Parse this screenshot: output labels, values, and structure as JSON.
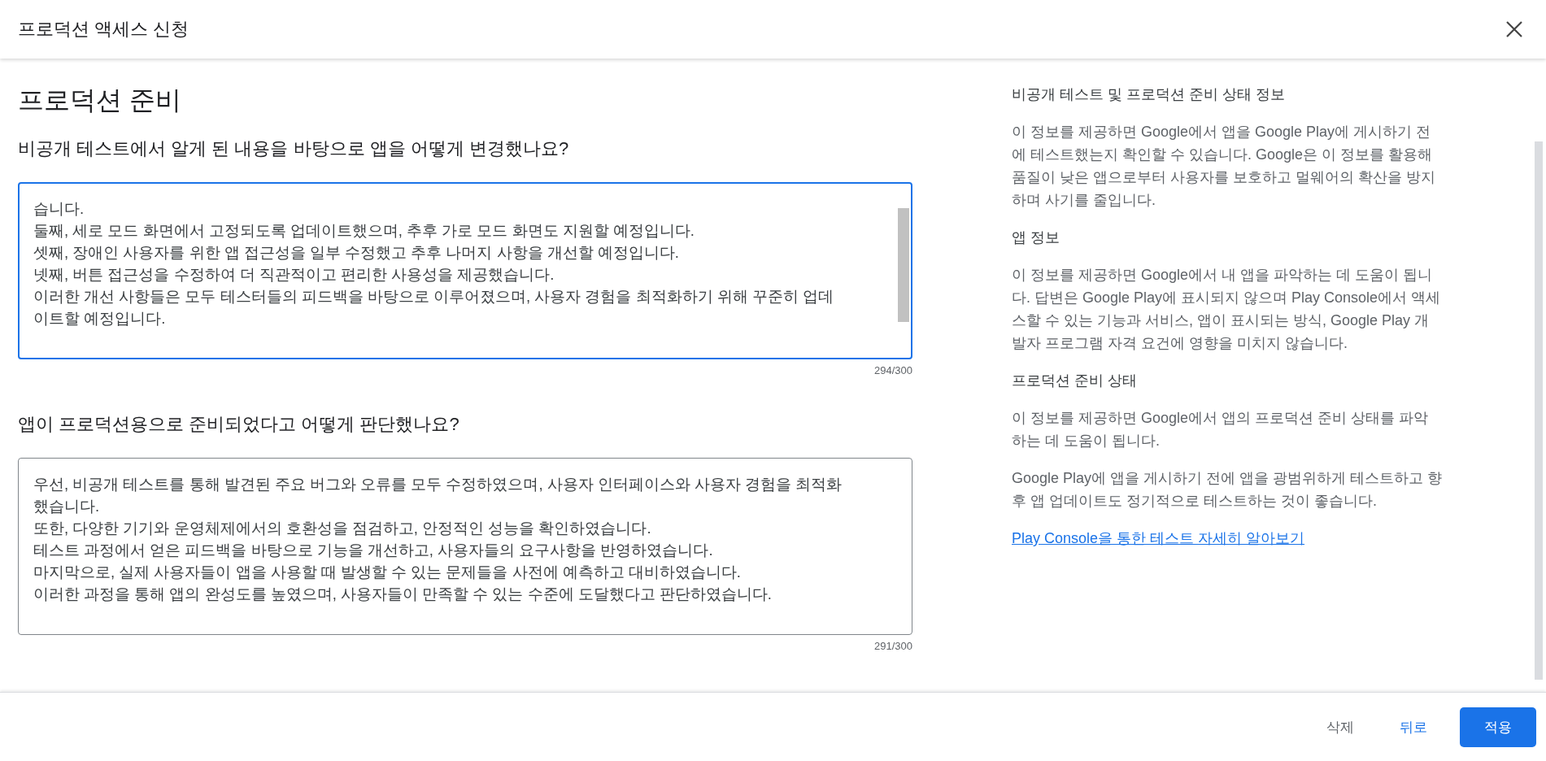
{
  "dialog": {
    "title": "프로덕션 액세스 신청"
  },
  "section_title": "프로덕션 준비",
  "questions": [
    {
      "label": "비공개 테스트에서 알게 된 내용을 바탕으로 앱을 어떻게 변경했나요?",
      "answer": "습니다.\n둘째, 세로 모드 화면에서 고정되도록 업데이트했으며, 추후 가로 모드 화면도 지원할 예정입니다.\n셋째, 장애인 사용자를 위한 앱 접근성을 일부 수정했고 추후 나머지 사항을 개선할 예정입니다.\n넷째, 버튼 접근성을 수정하여 더 직관적이고 편리한 사용성을 제공했습니다.\n이러한 개선 사항들은 모두 테스터들의 피드백을 바탕으로 이루어졌으며, 사용자 경험을 최적화하기 위해 꾸준히 업데\n이트할 예정입니다.",
      "counter": "294/300",
      "focused": true,
      "scrollable": true
    },
    {
      "label": "앱이 프로덕션용으로 준비되었다고 어떻게 판단했나요?",
      "answer": "우선, 비공개 테스트를 통해 발견된 주요 버그와 오류를 모두 수정하였으며, 사용자 인터페이스와 사용자 경험을 최적화\n했습니다.\n또한, 다양한 기기와 운영체제에서의 호환성을 점검하고, 안정적인 성능을 확인하였습니다.\n테스트 과정에서 얻은 피드백을 바탕으로 기능을 개선하고, 사용자들의 요구사항을 반영하였습니다.\n마지막으로, 실제 사용자들이 앱을 사용할 때 발생할 수 있는 문제들을 사전에 예측하고 대비하였습니다.\n이러한 과정을 통해 앱의 완성도를 높였으며, 사용자들이 만족할 수 있는 수준에 도달했다고 판단하였습니다.",
      "counter": "291/300",
      "focused": false,
      "scrollable": false
    }
  ],
  "help": {
    "sections": [
      {
        "heading": "비공개 테스트 및 프로덕션 준비 상태 정보",
        "paragraphs": [
          "이 정보를 제공하면 Google에서 앱을 Google Play에 게시하기 전에 테스트했는지 확인할 수 있습니다. Google은 이 정보를 활용해 품질이 낮은 앱으로부터 사용자를 보호하고 멀웨어의 확산을 방지하며 사기를 줄입니다."
        ]
      },
      {
        "heading": "앱 정보",
        "paragraphs": [
          "이 정보를 제공하면 Google에서 내 앱을 파악하는 데 도움이 됩니다. 답변은 Google Play에 표시되지 않으며 Play Console에서 액세스할 수 있는 기능과 서비스, 앱이 표시되는 방식, Google Play 개발자 프로그램 자격 요건에 영향을 미치지 않습니다."
        ]
      },
      {
        "heading": "프로덕션 준비 상태",
        "paragraphs": [
          "이 정보를 제공하면 Google에서 앱의 프로덕션 준비 상태를 파악하는 데 도움이 됩니다.",
          "Google Play에 앱을 게시하기 전에 앱을 광범위하게 테스트하고 향후 앱 업데이트도 정기적으로 테스트하는 것이 좋습니다."
        ]
      }
    ],
    "link": "Play Console을 통한 테스트 자세히 알아보기"
  },
  "footer": {
    "buttons": [
      {
        "label": "삭제",
        "kind": "text"
      },
      {
        "label": "뒤로",
        "kind": "link"
      },
      {
        "label": "적용",
        "kind": "primary"
      }
    ]
  }
}
